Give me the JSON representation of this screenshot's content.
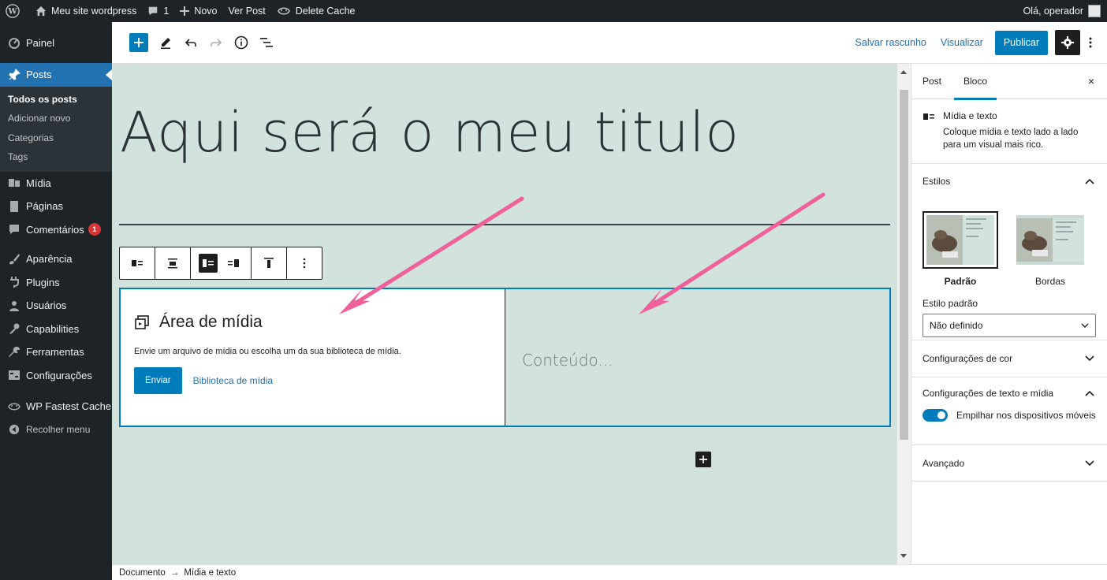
{
  "adminbar": {
    "site_name": "Meu site wordpress",
    "comments_count": "1",
    "new_label": "Novo",
    "view_post": "Ver Post",
    "delete_cache": "Delete Cache",
    "greeting": "Olá, operador"
  },
  "menu": {
    "painel": "Painel",
    "posts": "Posts",
    "submenu": [
      "Todos os posts",
      "Adicionar novo",
      "Categorias",
      "Tags"
    ],
    "midia": "Mídia",
    "paginas": "Páginas",
    "comentarios": "Comentários",
    "comentarios_badge": "1",
    "aparencia": "Aparência",
    "plugins": "Plugins",
    "usuarios": "Usuários",
    "capabilities": "Capabilities",
    "ferramentas": "Ferramentas",
    "configuracoes": "Configurações",
    "wp_fastest_cache": "WP Fastest Cache",
    "recolher": "Recolher menu"
  },
  "header": {
    "save_draft": "Salvar rascunho",
    "preview": "Visualizar",
    "publish": "Publicar"
  },
  "editor": {
    "post_title": "Aqui será o meu titulo",
    "media_area_title": "Área de mídia",
    "media_area_desc": "Envie um arquivo de mídia ou escolha um da sua biblioteca de mídia.",
    "upload_button": "Enviar",
    "library_link": "Biblioteca de mídia",
    "content_placeholder": "Conteúdo..."
  },
  "sidebar": {
    "tab_post": "Post",
    "tab_block": "Bloco",
    "close": "×",
    "block_name": "Mídia e texto",
    "block_desc": "Coloque mídia e texto lado a lado para um visual mais rico.",
    "styles_title": "Estilos",
    "style_default": "Padrão",
    "style_borders": "Bordas",
    "default_style_label": "Estilo padrão",
    "default_style_value": "Não definido",
    "color_settings": "Configurações de cor",
    "text_media_settings": "Configurações de texto e mídia",
    "stack_mobile": "Empilhar nos dispositivos móveis",
    "stack_mobile_on": true,
    "advanced": "Avançado"
  },
  "footer": {
    "breadcrumb_doc": "Documento",
    "breadcrumb_sep": "→",
    "breadcrumb_block": "Mídia e texto"
  },
  "colors": {
    "accent": "#007cba",
    "canvas_bg": "#d2e3dd",
    "admin_dark": "#1d2327",
    "annotation_arrow": "#f0609a"
  }
}
